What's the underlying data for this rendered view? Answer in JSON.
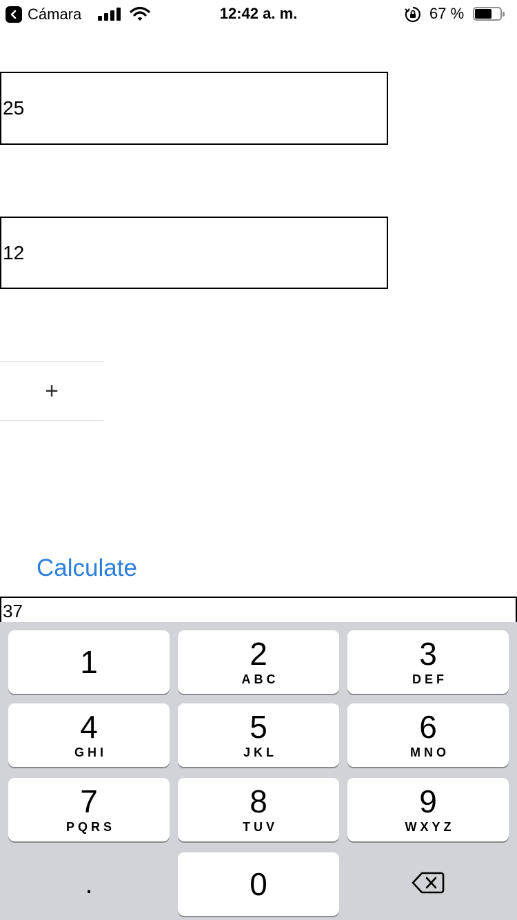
{
  "status_bar": {
    "back_app_label": "Cámara",
    "time": "12:42 a. m.",
    "battery_percent": "67 %",
    "battery_level": 0.67,
    "icons": [
      "back-arrow-icon",
      "cellular-signal-icon",
      "wifi-icon",
      "rotation-lock-icon",
      "battery-icon"
    ]
  },
  "form": {
    "first_number": "25",
    "second_number": "12",
    "operator": "+",
    "calculate_label": "Calculate",
    "result": "37"
  },
  "keyboard": {
    "keys": [
      {
        "digit": "1",
        "letters": ""
      },
      {
        "digit": "2",
        "letters": "ABC"
      },
      {
        "digit": "3",
        "letters": "DEF"
      },
      {
        "digit": "4",
        "letters": "GHI"
      },
      {
        "digit": "5",
        "letters": "JKL"
      },
      {
        "digit": "6",
        "letters": "MNO"
      },
      {
        "digit": "7",
        "letters": "PQRS"
      },
      {
        "digit": "8",
        "letters": "TUV"
      },
      {
        "digit": "9",
        "letters": "WXYZ"
      },
      {
        "digit": "0",
        "letters": ""
      }
    ],
    "decimal_key": ".",
    "delete_icon": "backspace-icon"
  },
  "colors": {
    "accent": "#2c7fd9",
    "keyboard_background": "#d1d3d9",
    "key_background": "#ffffff"
  }
}
